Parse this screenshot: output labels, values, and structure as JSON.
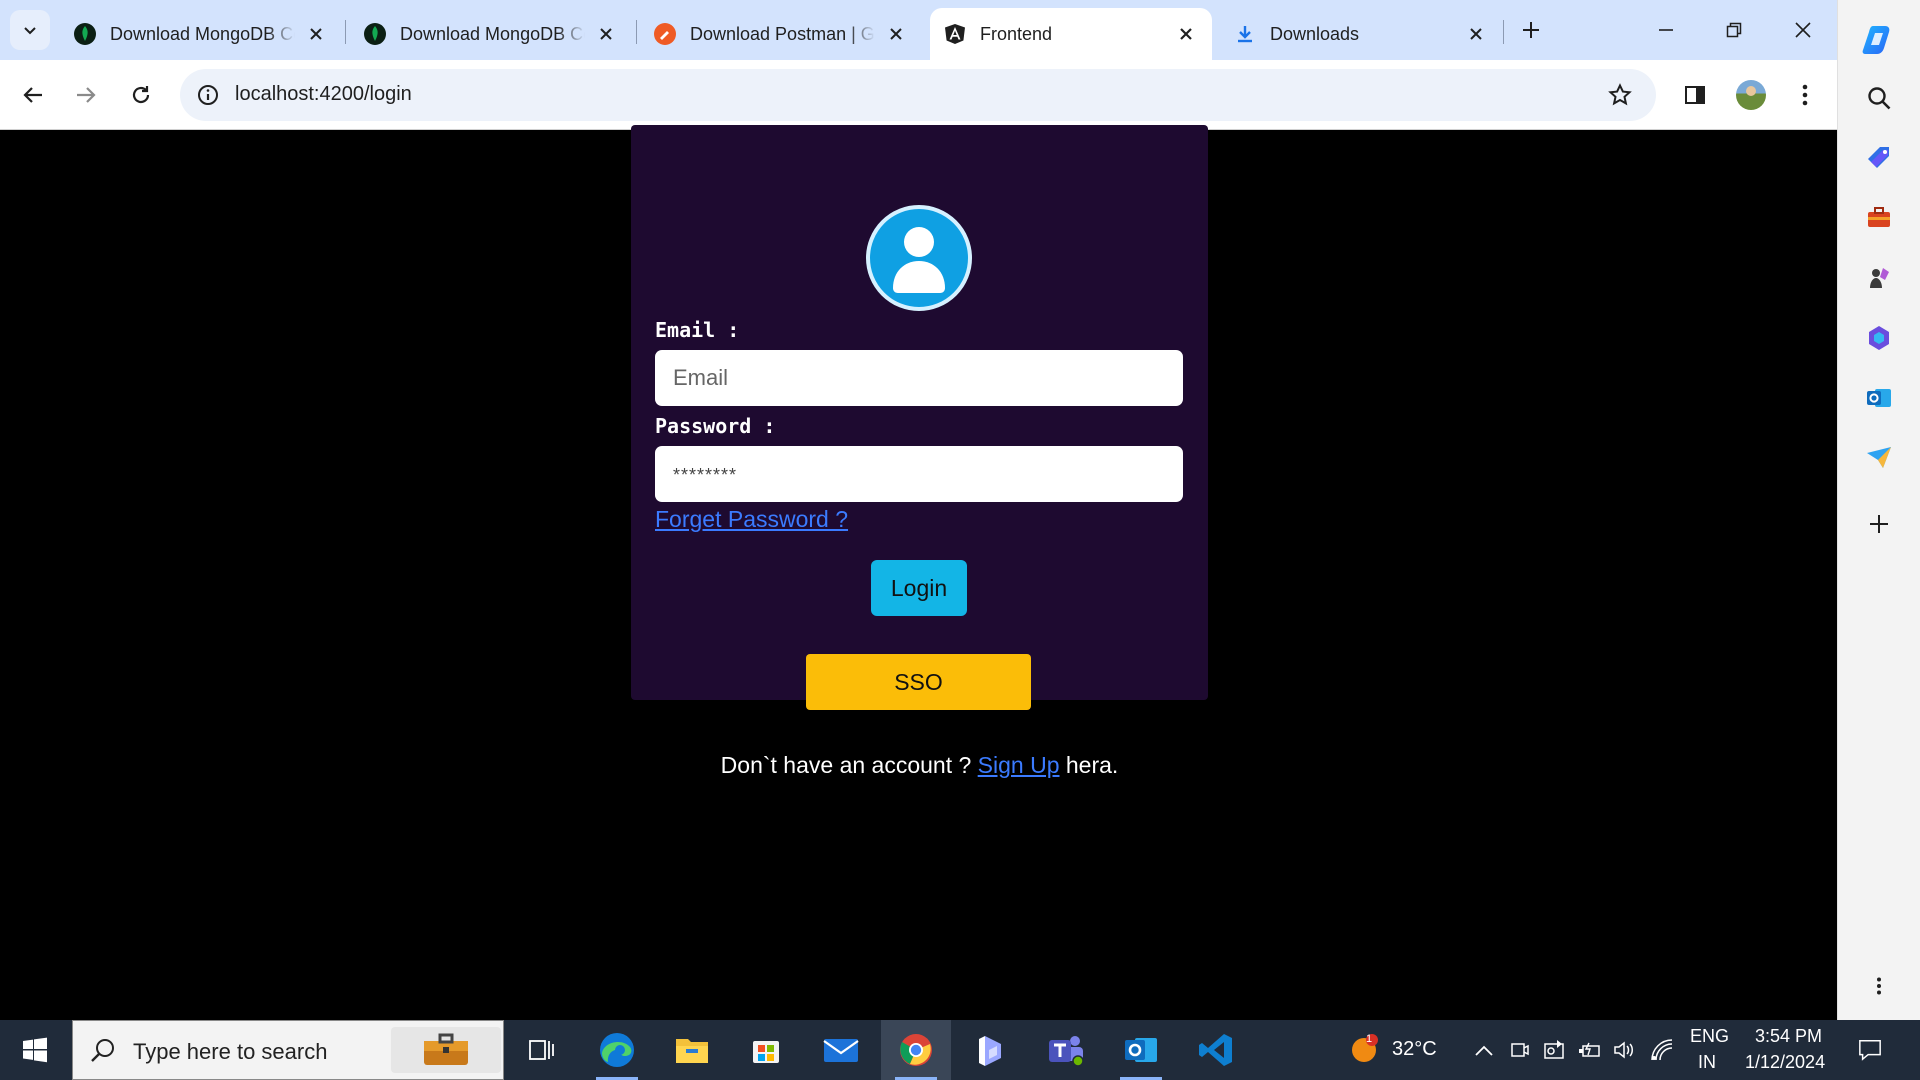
{
  "browser": {
    "tabs": [
      {
        "title": "Download MongoDB Community Server",
        "icon": "mongodb-leaf-icon",
        "active": false
      },
      {
        "title": "Download MongoDB Compass",
        "icon": "mongodb-leaf-icon",
        "active": false
      },
      {
        "title": "Download Postman | Get Started",
        "icon": "postman-icon",
        "active": false
      },
      {
        "title": "Frontend",
        "icon": "angular-icon",
        "active": true
      },
      {
        "title": "Downloads",
        "icon": "download-icon",
        "active": false
      }
    ],
    "url": "localhost:4200/login"
  },
  "login": {
    "email_label": "Email :",
    "email_placeholder": "Email",
    "password_label": "Password :",
    "password_placeholder": "********",
    "forgot_password": "Forget Password ?",
    "login_button": "Login",
    "sso_button": "SSO",
    "signup_prefix": "Don`t have an account ? ",
    "signup_link": "Sign Up",
    "signup_suffix": " hera."
  },
  "sidebar": {
    "icons": [
      "copilot-icon",
      "search-icon",
      "shopping-tag-icon",
      "tools-briefcase-icon",
      "games-icon",
      "microsoft-365-icon",
      "outlook-icon",
      "send-icon",
      "add-icon",
      "more-icon"
    ]
  },
  "taskbar": {
    "search_placeholder": "Type here to search",
    "apps": [
      "task-view-icon",
      "edge-icon",
      "file-explorer-icon",
      "microsoft-store-icon",
      "mail-icon",
      "chrome-icon",
      "bing-copilot-icon",
      "teams-icon",
      "outlook-icon",
      "vscode-icon"
    ],
    "weather_temp": "32°C",
    "weather_badge": "1",
    "language": "ENG",
    "region": "IN",
    "time": "3:54 PM",
    "date": "1/12/2024"
  },
  "colors": {
    "card_bg": "#1e0a30",
    "login_button": "#13b5e6",
    "sso_button": "#fbbd08",
    "link": "#3b7bff",
    "tabstrip": "#d3e3fd"
  }
}
